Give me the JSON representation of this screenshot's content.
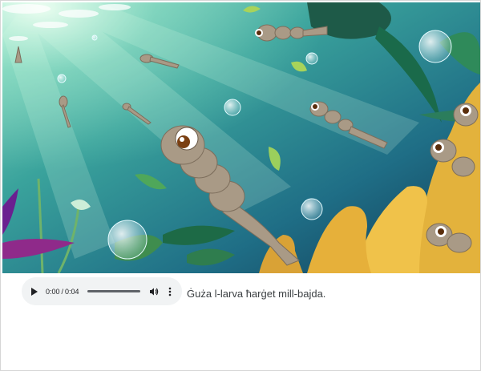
{
  "illustration": {
    "icon": "underwater-mosquito-larvae-illustration",
    "colors": {
      "water_light": "#5fc6a8",
      "water_dark": "#123a55",
      "coral": "#e3b23c",
      "larva": "#a99a86"
    }
  },
  "audio_player": {
    "current_time": "0:00",
    "separator": "/",
    "duration": "0:04",
    "progress": 0,
    "play_icon": "play-icon",
    "volume_icon": "volume-icon",
    "more_icon": "more-vertical-icon"
  },
  "caption": "Ġuża l-larva ħarġet mill-bajda."
}
